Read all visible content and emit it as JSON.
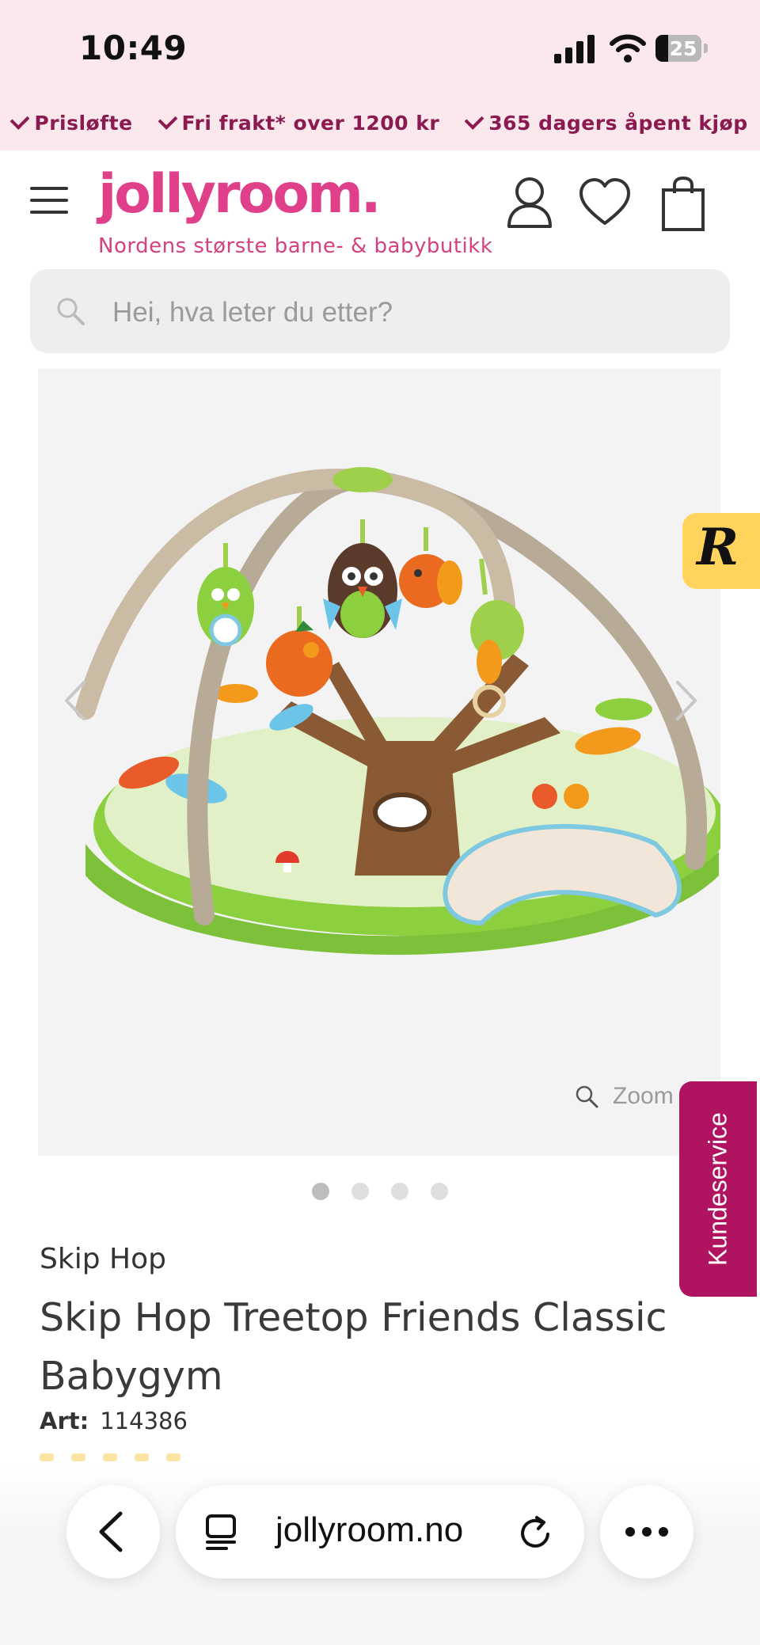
{
  "status_bar": {
    "time": "10:49",
    "battery": "25"
  },
  "promo": [
    "Prisløfte",
    "Fri frakt* over 1200 kr",
    "365 dagers åpent kjøp"
  ],
  "header": {
    "logo": "jollyroom.",
    "tagline": "Nordens største barne- & babybutikk",
    "icons": [
      "menu-icon",
      "account-icon",
      "wishlist-heart-icon",
      "cart-bag-icon"
    ]
  },
  "search": {
    "placeholder": "Hei, hva leter du etter?"
  },
  "gallery": {
    "zoom_label": "Zoom",
    "total_images": 4,
    "active_index": 0
  },
  "side_widgets": {
    "badge_letter": "R",
    "customer_service": "Kundeservice"
  },
  "product": {
    "brand": "Skip Hop",
    "title": "Skip Hop Treetop Friends Classic Babygym",
    "art_label": "Art:",
    "art_number": "114386"
  },
  "browser": {
    "url": "jollyroom.no"
  },
  "colors": {
    "brand_pink": "#e0408a",
    "promo_text": "#8a1a50",
    "top_bg": "#fbe8ec",
    "service_tab": "#b0135f",
    "badge_yellow": "#ffd35c"
  }
}
